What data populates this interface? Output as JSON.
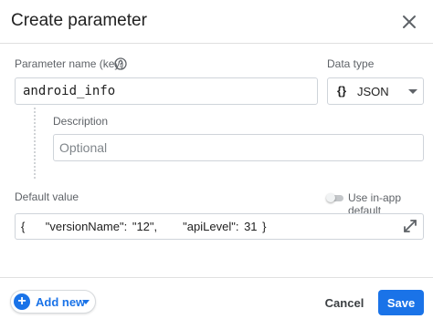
{
  "dialog": {
    "title": "Create parameter"
  },
  "form": {
    "name_label": "Parameter name (key)",
    "name_value": "android_info",
    "data_type_label": "Data type",
    "data_type_braces": "{}",
    "data_type_value": "JSON",
    "description_label": "Description",
    "description_placeholder": "Optional",
    "default_value_label": "Default value",
    "use_in_app_default_label": "Use in-app default",
    "use_in_app_default_on": false,
    "default_value": "{    \"versionName\": \"12\",     \"apiLevel\": 31 }"
  },
  "footer": {
    "add_new_label": "Add new",
    "cancel_label": "Cancel",
    "save_label": "Save"
  },
  "colors": {
    "primary": "#1a73e8",
    "text": "#212121",
    "secondary_text": "#5f6368",
    "border": "#cfd4da"
  },
  "icons": {
    "close": "close-icon",
    "help": "help-circle-icon",
    "expand": "expand-icon",
    "add": "add-circle-icon",
    "caret": "chevron-down-icon"
  }
}
